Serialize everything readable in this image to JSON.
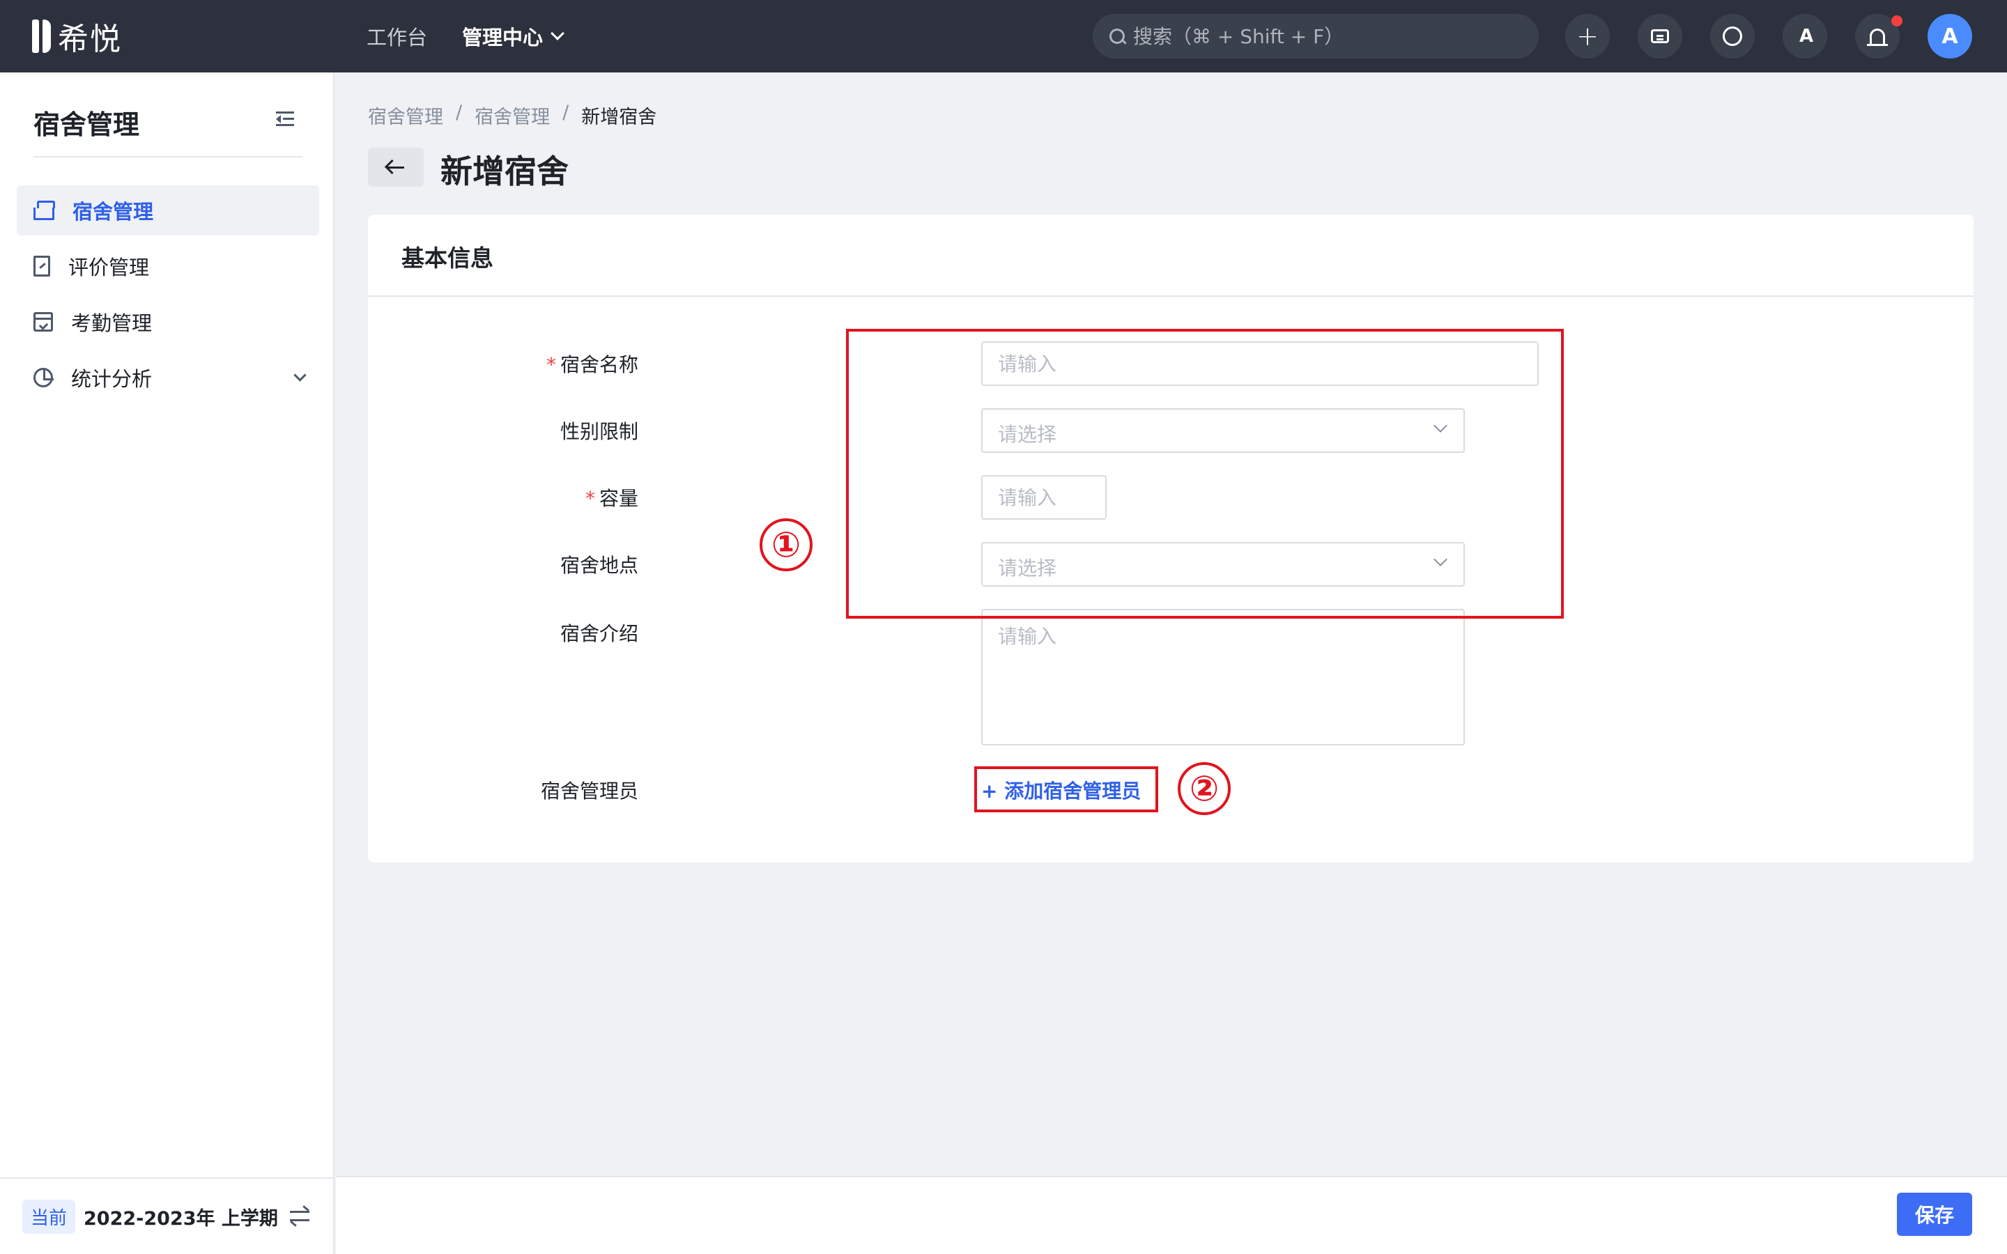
{
  "app": {
    "logo_text": "希悦"
  },
  "topnav": {
    "items": [
      {
        "label": "工作台"
      },
      {
        "label": "管理中心"
      }
    ]
  },
  "search": {
    "placeholder": "搜索（⌘ + Shift + F）"
  },
  "toolbar": {
    "plus_glyph": "+",
    "lang_glyph": "A",
    "avatar_initial": "A"
  },
  "sidebar": {
    "title": "宿舍管理",
    "items": [
      {
        "label": "宿舍管理",
        "icon": "bed-icon",
        "active": true
      },
      {
        "label": "评价管理",
        "icon": "doc-icon"
      },
      {
        "label": "考勤管理",
        "icon": "calendar-icon"
      },
      {
        "label": "统计分析",
        "icon": "pie-chart-icon"
      }
    ],
    "footer": {
      "badge": "当前",
      "term": "2022-2023年 上学期"
    }
  },
  "breadcrumb": {
    "items": [
      "宿舍管理",
      "宿舍管理",
      "新增宿舍"
    ],
    "separator": "/"
  },
  "page": {
    "title": "新增宿舍"
  },
  "card": {
    "title": "基本信息"
  },
  "form": {
    "required_mark": "*",
    "fields": [
      {
        "label": "宿舍名称",
        "required": true,
        "placeholder": "请输入",
        "value": ""
      },
      {
        "label": "性别限制",
        "required": false,
        "placeholder": "请选择",
        "value": ""
      },
      {
        "label": "容量",
        "required": true,
        "placeholder": "请输入",
        "value": ""
      },
      {
        "label": "宿舍地点",
        "required": false,
        "placeholder": "请选择",
        "value": ""
      },
      {
        "label": "宿舍介绍",
        "required": false,
        "placeholder": "请输入",
        "value": ""
      }
    ],
    "manager": {
      "label": "宿舍管理员",
      "add_link": "+ 添加宿舍管理员"
    }
  },
  "annotations": {
    "one": "①",
    "two": "②",
    "color": "#e1141e"
  },
  "footer": {
    "save_label": "保存"
  },
  "colors": {
    "accent": "#3060e8",
    "topbar": "#2c313d",
    "required": "#f53f3f",
    "primary_button": "#3d6df5"
  }
}
